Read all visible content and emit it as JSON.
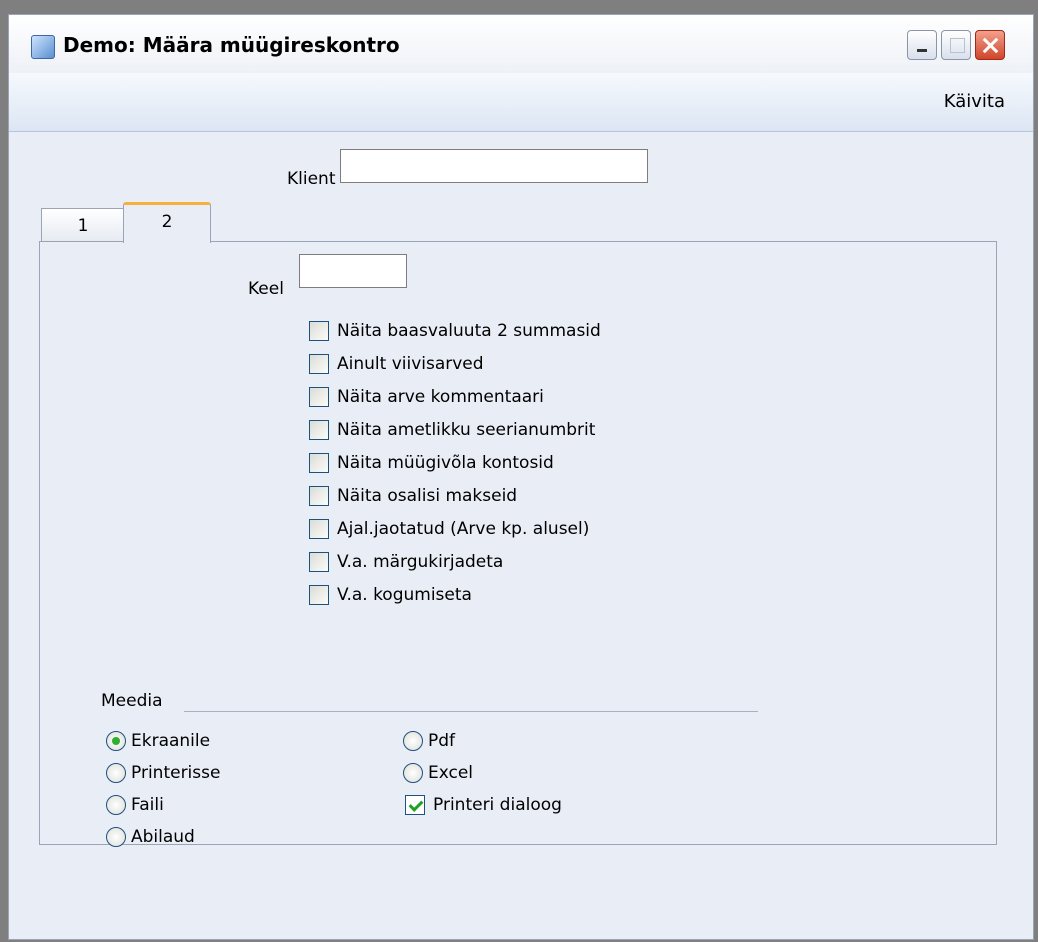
{
  "window": {
    "title": "Demo: Määra müügireskontro"
  },
  "toolbar": {
    "run_label": "Käivita"
  },
  "form": {
    "client_label": "Klient",
    "client_value": ""
  },
  "tabs": [
    {
      "label": "1"
    },
    {
      "label": "2"
    }
  ],
  "tab2": {
    "language_label": "Keel",
    "language_value": "",
    "checkboxes": [
      {
        "label": "Näita baasvaluuta 2 summasid",
        "checked": false
      },
      {
        "label": "Ainult viivisarved",
        "checked": false
      },
      {
        "label": "Näita arve kommentaari",
        "checked": false
      },
      {
        "label": "Näita ametlikku seerianumbrit",
        "checked": false
      },
      {
        "label": "Näita müügivõla kontosid",
        "checked": false
      },
      {
        "label": "Näita osalisi makseid",
        "checked": false
      },
      {
        "label": "Ajal.jaotatud (Arve kp. alusel)",
        "checked": false
      },
      {
        "label": "V.a. märgukirjadeta",
        "checked": false
      },
      {
        "label": "V.a. kogumiseta",
        "checked": false
      }
    ]
  },
  "media": {
    "title": "Meedia",
    "options": [
      {
        "label": "Ekraanile",
        "selected": true
      },
      {
        "label": "Printerisse",
        "selected": false
      },
      {
        "label": "Faili",
        "selected": false
      },
      {
        "label": "Abilaud",
        "selected": false
      },
      {
        "label": "Pdf",
        "selected": false
      },
      {
        "label": "Excel",
        "selected": false
      }
    ],
    "printer_dialog": {
      "label": "Printeri dialoog",
      "checked": true
    }
  }
}
